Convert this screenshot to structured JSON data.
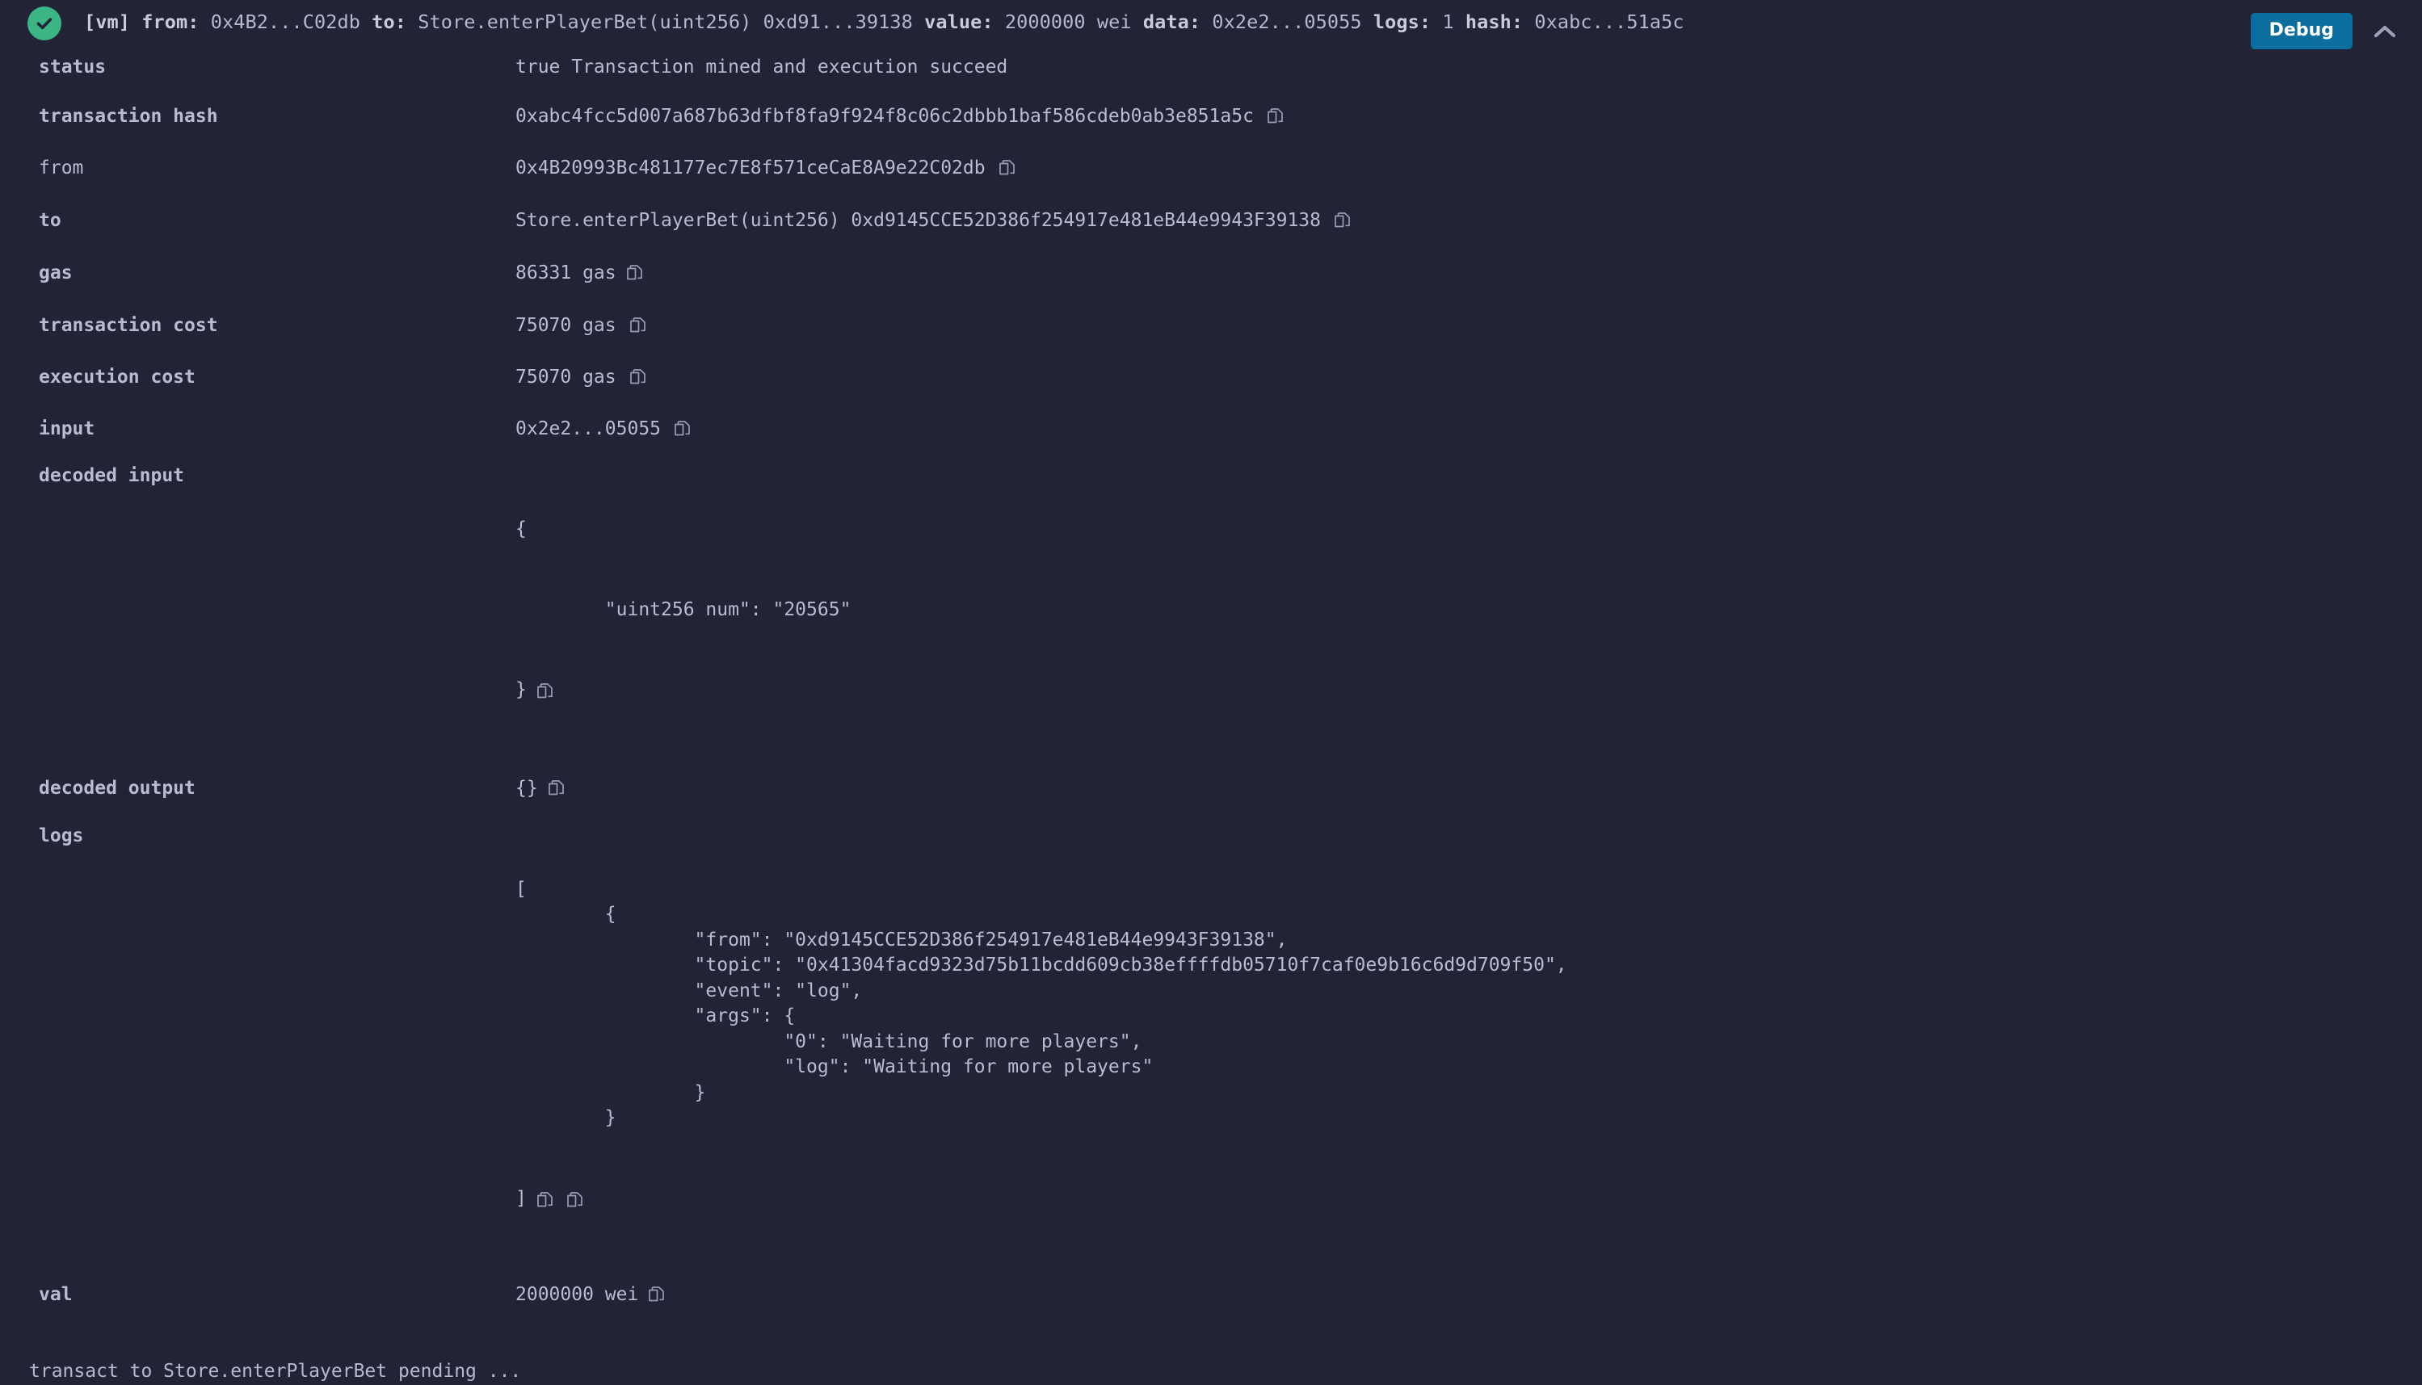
{
  "header": {
    "status_icon": "check-circle-icon",
    "status_ok": true,
    "vm_tag": "[vm]",
    "from_key": "from:",
    "from_val": "0x4B2...C02db",
    "to_key": "to:",
    "to_val": "Store.enterPlayerBet(uint256) 0xd91...39138",
    "value_key": "value:",
    "value_val": "2000000 wei",
    "data_key": "data:",
    "data_val": "0x2e2...05055",
    "logs_key": "logs:",
    "logs_val": "1",
    "hash_key": "hash:",
    "hash_val": "0xabc...51a5c",
    "debug_label": "Debug",
    "collapse_icon": "chevron-up-icon"
  },
  "receipt": {
    "status": {
      "label": "status",
      "value": "true Transaction mined and execution succeed"
    },
    "transaction_hash": {
      "label": "transaction hash",
      "value": "0xabc4fcc5d007a687b63dfbf8fa9f924f8c06c2dbbb1baf586cdeb0ab3e851a5c"
    },
    "from": {
      "label": "from",
      "value": "0x4B20993Bc481177ec7E8f571ceCaE8A9e22C02db"
    },
    "to": {
      "label": "to",
      "value": "Store.enterPlayerBet(uint256) 0xd9145CCE52D386f254917e481eB44e9943F39138"
    },
    "gas": {
      "label": "gas",
      "value": "86331 gas"
    },
    "transaction_cost": {
      "label": "transaction cost",
      "value": "75070 gas"
    },
    "execution_cost": {
      "label": "execution cost",
      "value": "75070 gas"
    },
    "input": {
      "label": "input",
      "value": "0x2e2...05055"
    },
    "decoded_input": {
      "label": "decoded input",
      "line_open": "{",
      "line_body": "        \"uint256 num\": \"20565\"",
      "line_close": "}"
    },
    "decoded_output": {
      "label": "decoded output",
      "value": "{}"
    },
    "logs": {
      "label": "logs",
      "body": "[\n        {\n                \"from\": \"0xd9145CCE52D386f254917e481eB44e9943F39138\",\n                \"topic\": \"0x41304facd9323d75b11bcdd609cb38effffdb05710f7caf0e9b16c6d9d709f50\",\n                \"event\": \"log\",\n                \"args\": {\n                        \"0\": \"Waiting for more players\",\n                        \"log\": \"Waiting for more players\"\n                }\n        }",
      "line_close": "]"
    },
    "val": {
      "label": "val",
      "value": "2000000 wei"
    }
  },
  "console": {
    "pending_message": "transact to Store.enterPlayerBet pending ..."
  },
  "icons": {
    "copy": "copy-icon"
  },
  "colors": {
    "background": "#222336",
    "text": "#b9bbd0",
    "success": "#3bb584",
    "debug_button": "#0c6e9e",
    "debug_button_text": "#ffffff"
  }
}
